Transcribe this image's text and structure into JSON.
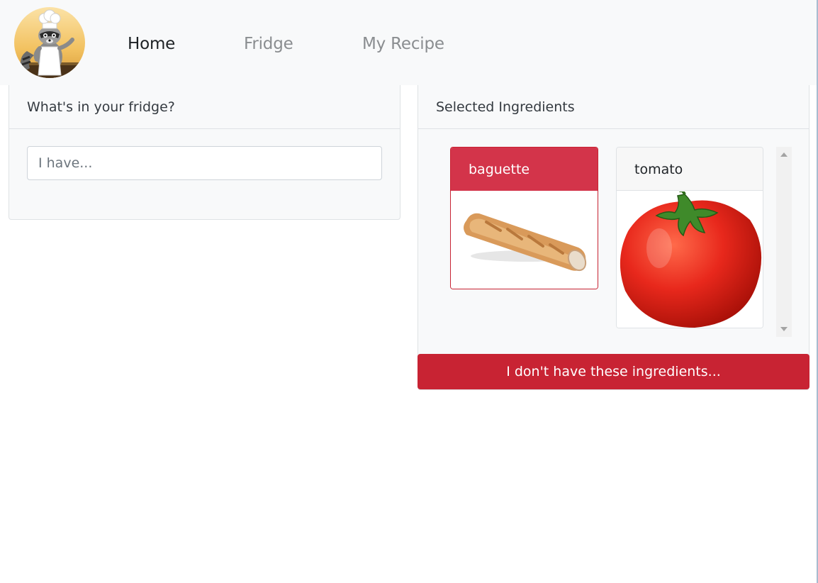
{
  "nav": {
    "logo": "raccoon-chef-logo",
    "links": [
      "Home",
      "Fridge",
      "My Recipe"
    ],
    "active": "Home"
  },
  "fridge": {
    "title": "What's in your fridge?",
    "search_placeholder": "I have...",
    "search_value": ""
  },
  "selected": {
    "title": "Selected Ingredients",
    "ingredients": [
      {
        "name": "baguette",
        "state": "selected",
        "color": "#d3344a"
      },
      {
        "name": "tomato",
        "state": "default"
      }
    ],
    "action_label": "I don't have these ingredients...",
    "action_color": "#c82333"
  }
}
